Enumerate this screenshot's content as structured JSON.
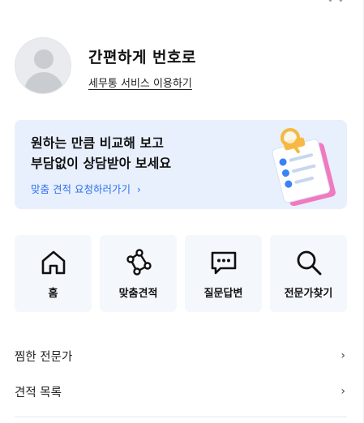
{
  "profile": {
    "title": "간편하게 번호로",
    "link": "세무통 서비스 이용하기"
  },
  "banner": {
    "title_line1": "원하는 만큼 비교해 보고",
    "title_line2": "부담없이 상담받아 보세요",
    "cta": "맞춤 견적 요청하러가기",
    "cta_arrow": "›"
  },
  "quick_menu": [
    {
      "label": "홈",
      "icon": "home-icon"
    },
    {
      "label": "맞춤견적",
      "icon": "nodes-icon"
    },
    {
      "label": "질문답변",
      "icon": "chat-icon"
    },
    {
      "label": "전문가찾기",
      "icon": "search-icon"
    }
  ],
  "menu_list": [
    {
      "label": "찜한 전문가",
      "arrow": "›"
    },
    {
      "label": "견적 목록",
      "arrow": "›"
    }
  ],
  "colors": {
    "accent": "#2f6ef0",
    "banner_bg": "#e8f0fd",
    "tile_bg": "#f4f7fc"
  }
}
